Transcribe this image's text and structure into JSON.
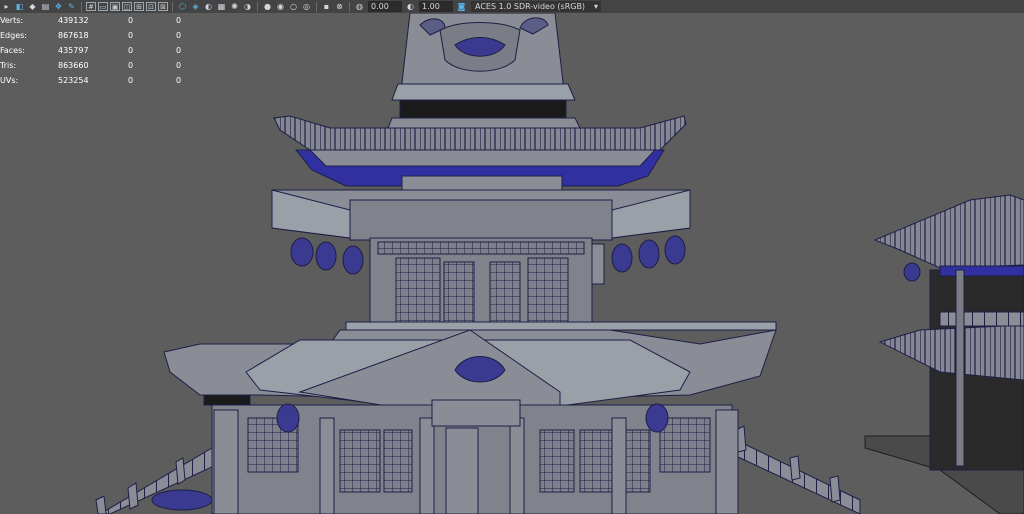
{
  "toolbar": {
    "icons_left": [
      "select-camera-icon",
      "camera-attributes-icon",
      "bookmark-icon",
      "image-plane-icon",
      "2d-pan-icon",
      "grease-pencil-icon"
    ],
    "icons_grid": [
      "grid-icon",
      "film-gate-icon",
      "resolution-gate-icon",
      "gate-mask-icon",
      "field-chart-icon",
      "safe-action-icon",
      "safe-title-icon"
    ],
    "icons_shading": [
      "wireframe-icon",
      "smooth-shade-icon",
      "default-material-icon",
      "textured-icon",
      "use-all-lights-icon",
      "shadows-icon",
      "screen-space-ao-icon",
      "motion-blur-icon",
      "anti-alias-icon",
      "depth-of-field-icon"
    ],
    "exposure_value": "0.00",
    "gamma_value": "1.00",
    "color_space": "ACES 1.0 SDR-video (sRGB)"
  },
  "hud": {
    "rows": [
      {
        "label": "Verts:",
        "v1": "439132",
        "v2": "0",
        "v3": "0"
      },
      {
        "label": "Edges:",
        "v1": "867618",
        "v2": "0",
        "v3": "0"
      },
      {
        "label": "Faces:",
        "v1": "435797",
        "v2": "0",
        "v3": "0"
      },
      {
        "label": "Tris:",
        "v1": "863660",
        "v2": "0",
        "v3": "0"
      },
      {
        "label": "UVs:",
        "v1": "523254",
        "v2": "0",
        "v3": "0"
      }
    ]
  },
  "colors": {
    "background": "#5d5d5d",
    "mesh_fill": "#8a8d96",
    "wire": "#1e1e46",
    "wire_highlight": "#3030a0",
    "toolbar_bg": "#444444"
  }
}
